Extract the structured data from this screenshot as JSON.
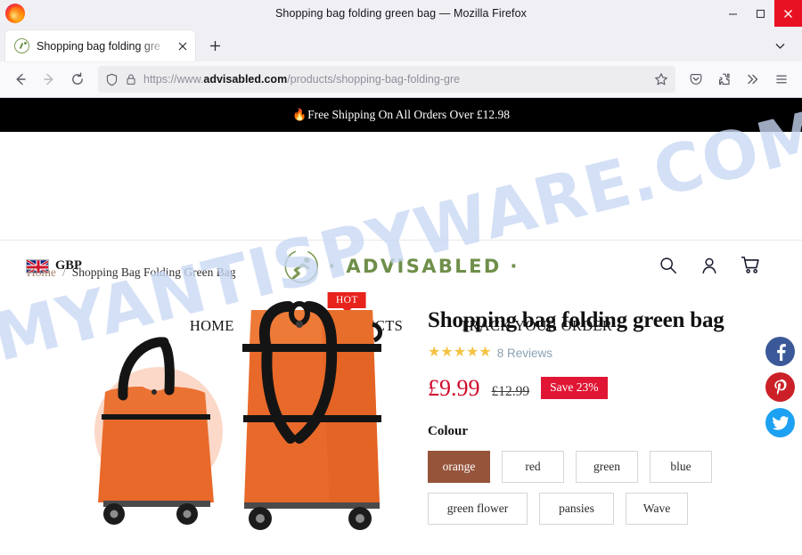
{
  "browser": {
    "window_title": "Shopping bag folding green bag — Mozilla Firefox",
    "tab_title": "Shopping bag folding gre",
    "url_scheme": "https://www.",
    "url_domain": "advisabled.com",
    "url_path": "/products/shopping-bag-folding-gre",
    "minimize_label": "Minimize",
    "maximize_label": "Maximize",
    "close_label": "Close",
    "new_tab_label": "New tab",
    "back_label": "Back",
    "forward_label": "Forward",
    "reload_label": "Reload"
  },
  "site": {
    "promo_flame": "🔥",
    "promo_text": "Free Shipping On All Orders Over £12.98",
    "currency": "GBP",
    "logo_text": "· ADVISABLED ·",
    "nav": [
      {
        "label": "HOME",
        "badge": ""
      },
      {
        "label": "ALL PRODUCTS",
        "badge": "HOT"
      },
      {
        "label": "TRACK YOUR ORDER",
        "badge": ""
      }
    ],
    "icons": {
      "search": "search-icon",
      "account": "user-icon",
      "cart": "cart-icon"
    }
  },
  "breadcrumb": {
    "home": "Home",
    "separator": "/",
    "current": "Shopping Bag Folding Green Bag"
  },
  "product": {
    "title": "Shopping bag folding green bag",
    "stars": "★★★★★",
    "reviews": "8 Reviews",
    "price_now": "£9.99",
    "price_was": "£12.99",
    "save_badge": "Save 23%",
    "option_label": "Colour",
    "options": [
      {
        "label": "orange",
        "selected": true
      },
      {
        "label": "red",
        "selected": false
      },
      {
        "label": "green",
        "selected": false
      },
      {
        "label": "blue",
        "selected": false
      },
      {
        "label": "green flower",
        "selected": false
      },
      {
        "label": "pansies",
        "selected": false
      },
      {
        "label": "Wave",
        "selected": false
      }
    ]
  },
  "social": [
    {
      "name": "facebook",
      "glyph": "f"
    },
    {
      "name": "pinterest",
      "glyph": "P"
    },
    {
      "name": "twitter",
      "glyph": "t"
    }
  ],
  "watermark": {
    "text": "MYANTISPYWARE.COM"
  },
  "colors": {
    "promo_bg": "#000000",
    "brand_green": "#6f8f4a",
    "sale_red": "#cf0a2c",
    "badge_red": "#e7231b",
    "selected_swatch": "#96543a",
    "star_yellow": "#f5c343",
    "watermark_blue": "#c8d8f4"
  }
}
